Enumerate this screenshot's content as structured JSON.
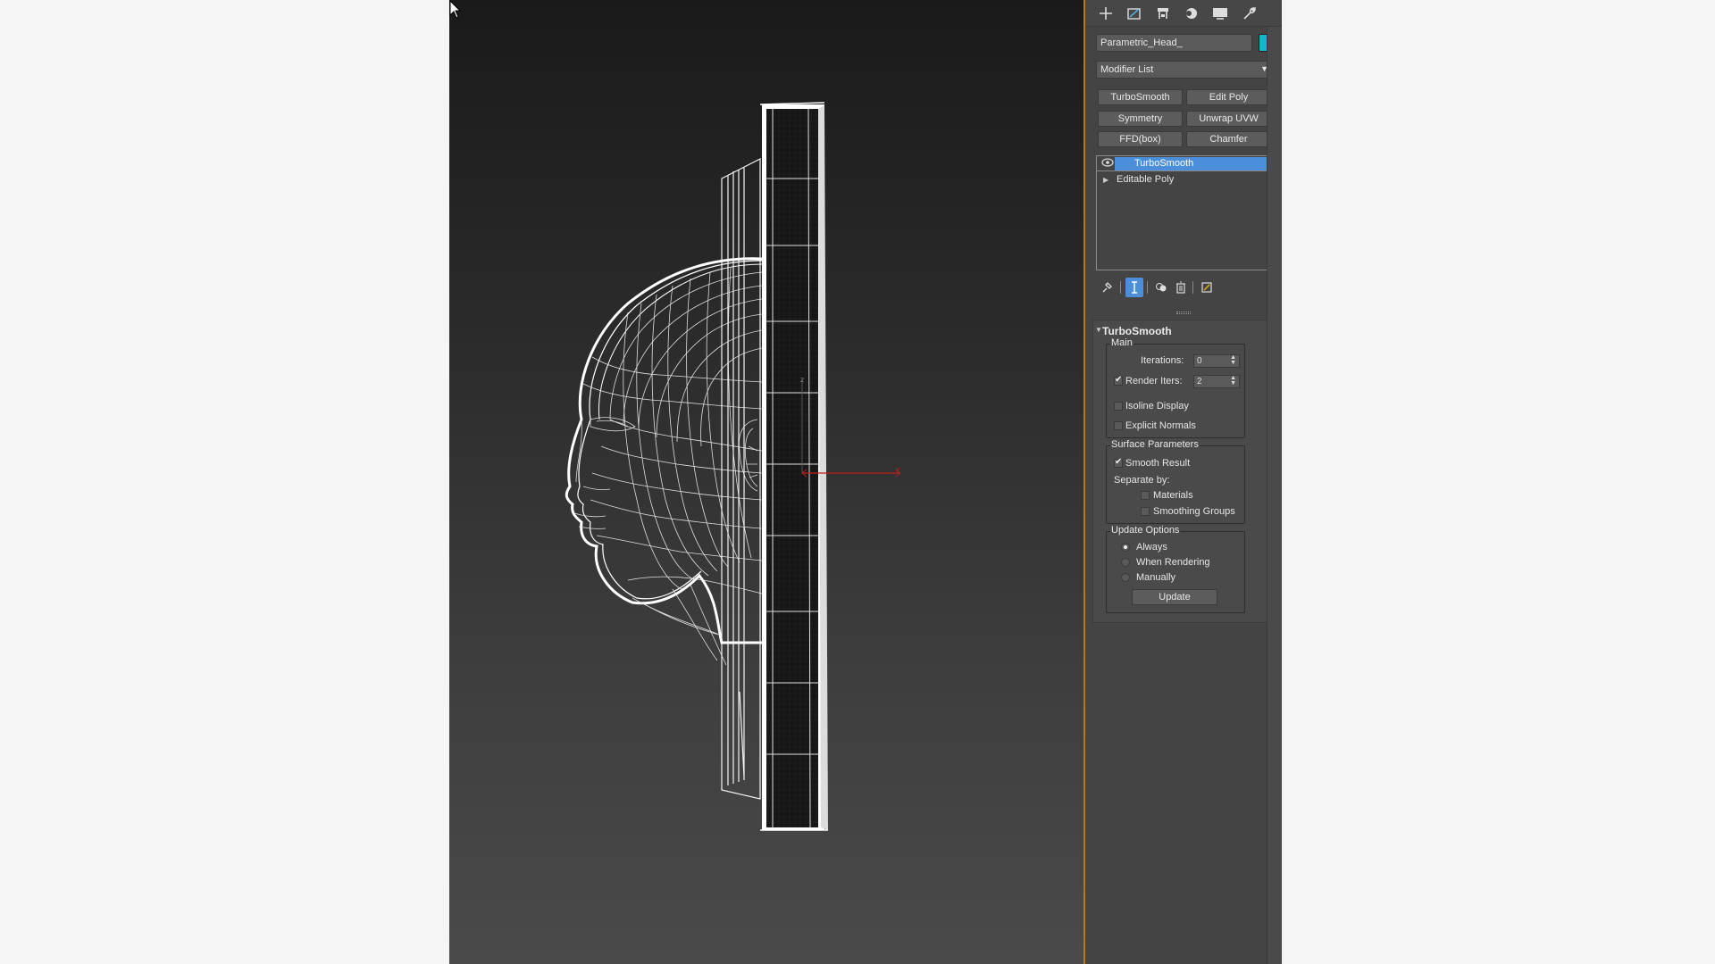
{
  "object": {
    "name": "Parametric_Head_",
    "color": "#18b4c8"
  },
  "panel_tabs": [
    {
      "icon": "plus-icon",
      "name": "create-tab"
    },
    {
      "icon": "modify-icon",
      "name": "modify-tab"
    },
    {
      "icon": "hierarchy-icon",
      "name": "hierarchy-tab"
    },
    {
      "icon": "motion-icon",
      "name": "motion-tab"
    },
    {
      "icon": "display-icon",
      "name": "display-tab"
    },
    {
      "icon": "wrench-icon",
      "name": "utilities-tab"
    }
  ],
  "modifier_list": {
    "label": "Modifier List"
  },
  "modifier_buttons": [
    "TurboSmooth",
    "Edit Poly",
    "Symmetry",
    "Unwrap UVW",
    "FFD(box)",
    "Chamfer"
  ],
  "stack": [
    {
      "label": "TurboSmooth",
      "selected": true
    },
    {
      "label": "Editable Poly",
      "selected": false
    }
  ],
  "rollout": {
    "title": "TurboSmooth",
    "main": {
      "title": "Main",
      "iterations_label": "Iterations:",
      "iterations_value": "0",
      "render_iters_label": "Render Iters:",
      "render_iters_value": "2",
      "render_iters_checked": true,
      "isoline_label": "Isoline Display",
      "isoline_checked": false,
      "explicit_label": "Explicit Normals",
      "explicit_checked": false
    },
    "surface": {
      "title": "Surface Parameters",
      "smooth_label": "Smooth Result",
      "smooth_checked": true,
      "separate_label": "Separate by:",
      "materials_label": "Materials",
      "smoothing_groups_label": "Smoothing Groups"
    },
    "update": {
      "title": "Update Options",
      "always": "Always",
      "when_rendering": "When Rendering",
      "manually": "Manually",
      "selected": "Always",
      "button": "Update"
    }
  },
  "gizmo": {
    "y_label": "y",
    "z_label": "z"
  }
}
